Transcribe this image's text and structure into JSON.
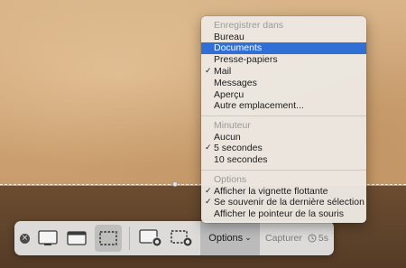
{
  "menu": {
    "save_section": {
      "header": "Enregistrer dans",
      "items": [
        {
          "label": "Bureau",
          "checked": false,
          "highlighted": false
        },
        {
          "label": "Documents",
          "checked": false,
          "highlighted": true
        },
        {
          "label": "Presse-papiers",
          "checked": false,
          "highlighted": false
        },
        {
          "label": "Mail",
          "checked": true,
          "highlighted": false
        },
        {
          "label": "Messages",
          "checked": false,
          "highlighted": false
        },
        {
          "label": "Aperçu",
          "checked": false,
          "highlighted": false
        },
        {
          "label": "Autre emplacement...",
          "checked": false,
          "highlighted": false
        }
      ]
    },
    "timer_section": {
      "header": "Minuteur",
      "items": [
        {
          "label": "Aucun",
          "checked": false
        },
        {
          "label": "5 secondes",
          "checked": true
        },
        {
          "label": "10 secondes",
          "checked": false
        }
      ]
    },
    "options_section": {
      "header": "Options",
      "items": [
        {
          "label": "Afficher la vignette flottante",
          "checked": true
        },
        {
          "label": "Se souvenir de la dernière sélection",
          "checked": true
        },
        {
          "label": "Afficher le pointeur de la souris",
          "checked": false
        }
      ]
    },
    "check_glyph": "✓"
  },
  "toolbar": {
    "close_glyph": "×",
    "options_label": "Options",
    "options_chevron": "⌄",
    "capture_label": "Capturer",
    "timer_label": "5s",
    "icons": [
      "close-icon",
      "capture-entire-screen-icon",
      "capture-window-icon",
      "capture-selection-icon",
      "record-entire-screen-icon",
      "record-selection-icon",
      "timer-icon"
    ]
  },
  "colors": {
    "highlight": "#2f6fd6",
    "menu_bg": "#ece8e2",
    "toolbar_bg": "#e4e4e4"
  }
}
